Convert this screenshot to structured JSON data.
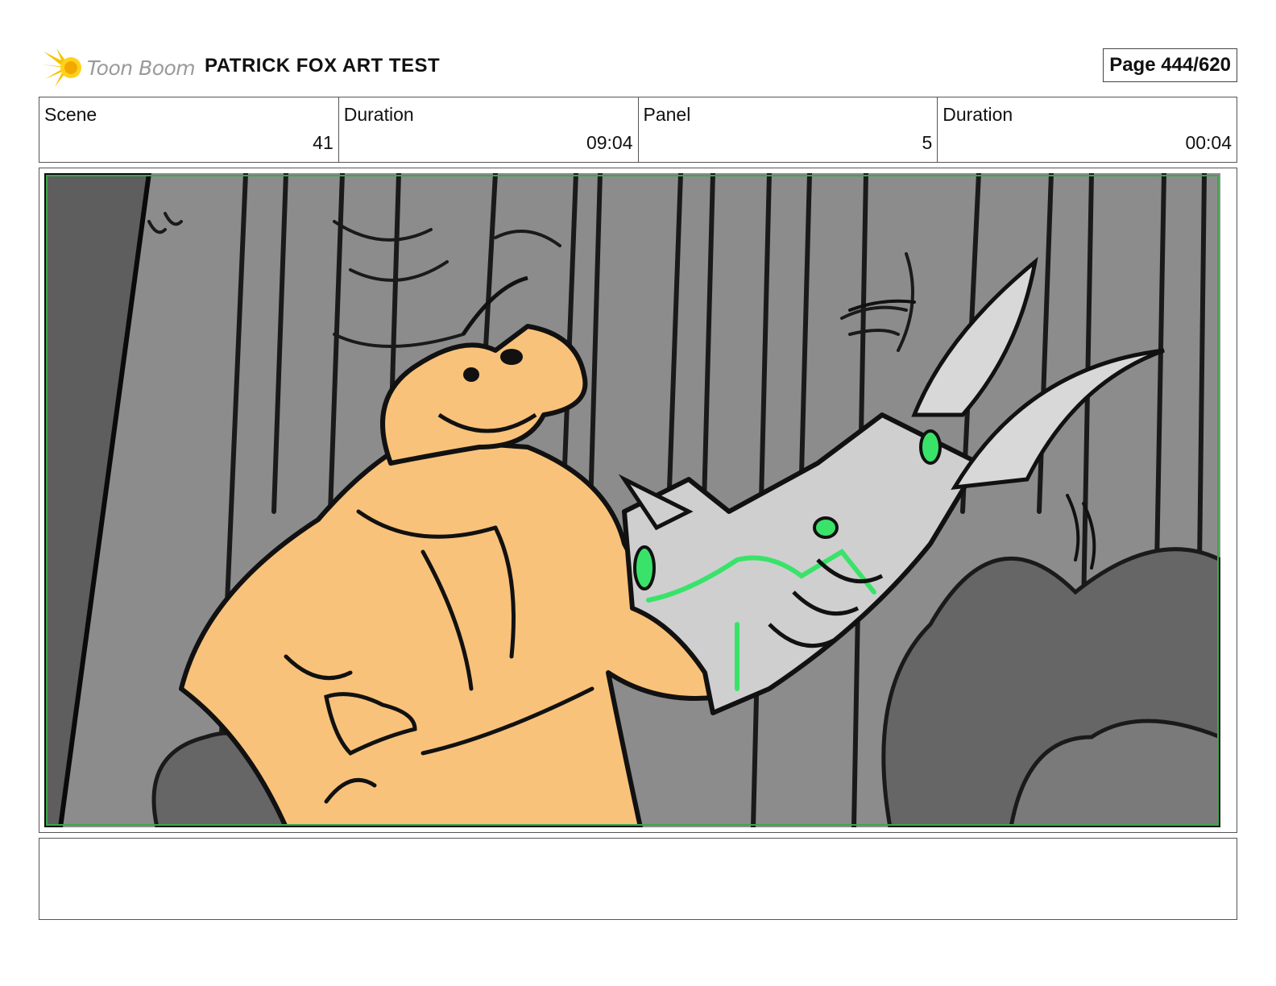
{
  "header": {
    "logo_text": "Toon Boom",
    "project_title": "PATRICK FOX ART TEST",
    "page_label": "Page 444/620"
  },
  "info": {
    "scene_label": "Scene",
    "scene_value": "41",
    "duration_label": "Duration",
    "duration_value": "09:04",
    "panel_label": "Panel",
    "panel_value": "5",
    "panel_duration_label": "Duration",
    "panel_duration_value": "00:04"
  },
  "notes": {
    "text": ""
  },
  "colors": {
    "accent_green": "#39e36a",
    "character_orange": "#f9c27a",
    "forest_gray": "#8c8c8c",
    "gadget_gray": "#cfcfcf",
    "logo_yellow": "#f5c400"
  }
}
